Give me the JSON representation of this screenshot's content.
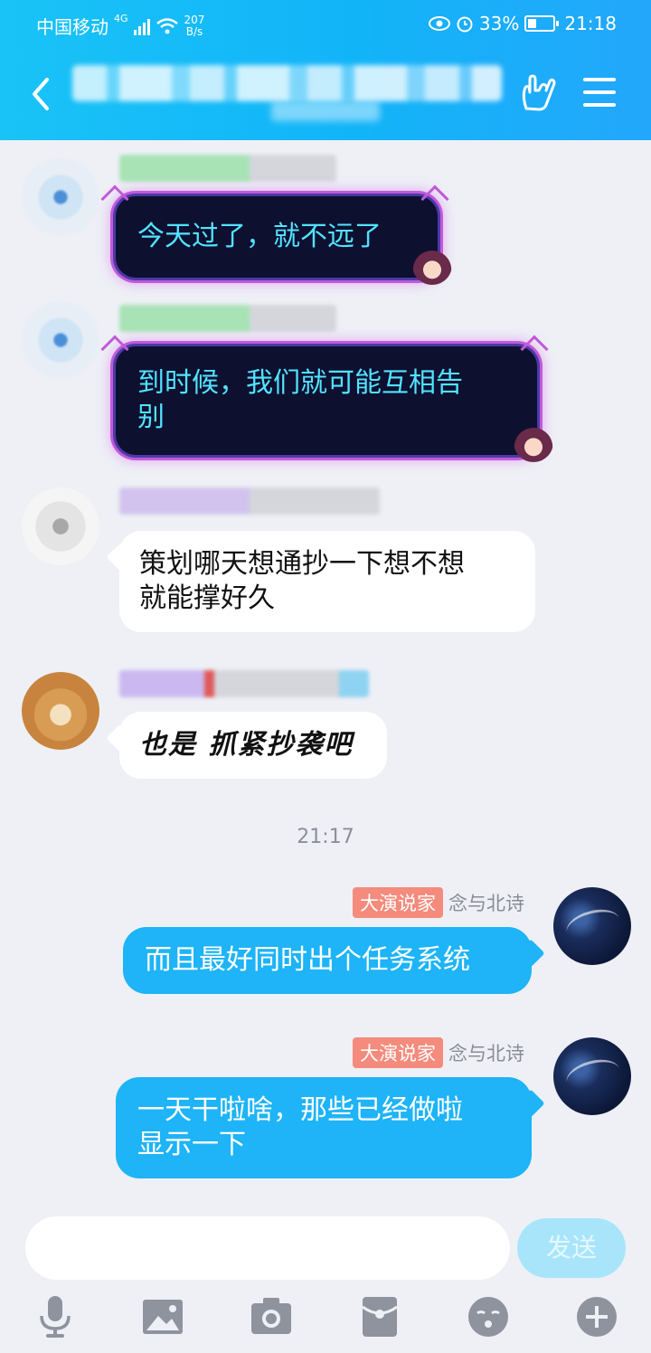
{
  "status_bar": {
    "carrier": "中国移动",
    "network": "4G",
    "speed_value": "207",
    "speed_unit": "B/s",
    "battery": "33%",
    "time": "21:18"
  },
  "messages": [
    {
      "side": "left",
      "style": "dark-themed",
      "text": "今天过了，就不远了"
    },
    {
      "side": "left",
      "style": "dark-themed",
      "text_line1": "到时候，我们就可能互相告",
      "text_line2": "别"
    },
    {
      "side": "left",
      "style": "white",
      "text_line1": "策划哪天想通抄一下想不想",
      "text_line2": "就能撑好久"
    },
    {
      "side": "left",
      "style": "white",
      "text": "也是 抓紧抄袭吧"
    },
    {
      "side": "right",
      "badge": "大演说家",
      "sender": "念与北诗",
      "text": "而且最好同时出个任务系统"
    },
    {
      "side": "right",
      "badge": "大演说家",
      "sender": "念与北诗",
      "text_line1": "一天干啦啥，那些已经做啦",
      "text_line2": "显示一下"
    }
  ],
  "timestamp": "21:17",
  "input_bar": {
    "send_label": "发送",
    "tools": [
      "microphone-icon",
      "image-icon",
      "camera-icon",
      "red-packet-icon",
      "emoji-icon",
      "plus-icon"
    ]
  },
  "colors": {
    "header": "#19c3f7",
    "my_bubble": "#1eb4f7",
    "badge": "#f48b7c",
    "dark_bubble_text": "#52e3ff"
  }
}
